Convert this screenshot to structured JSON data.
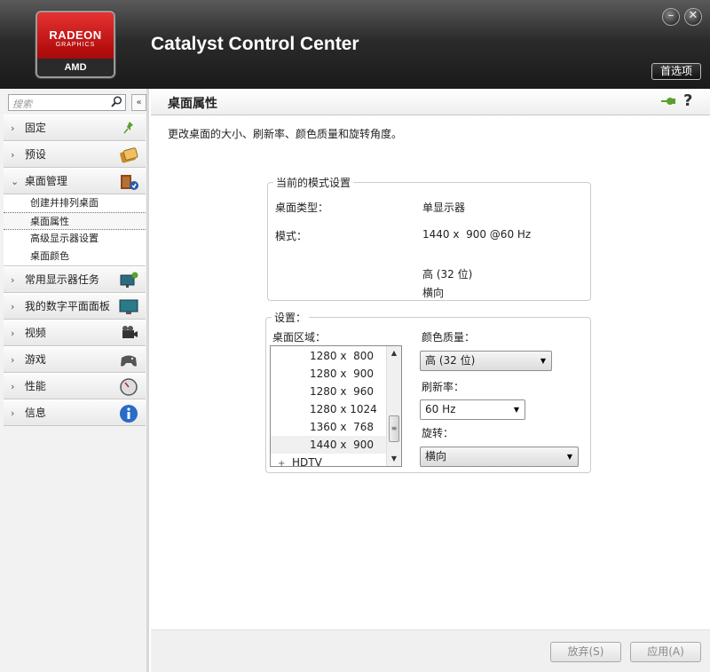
{
  "header": {
    "logo": {
      "line1": "RADEON",
      "line2": "GRAPHICS",
      "brand": "AMD"
    },
    "title": "Catalyst Control Center",
    "preferences_label": "首选项",
    "minimize_glyph": "–",
    "close_glyph": "✕"
  },
  "sidebar": {
    "search_placeholder": "搜索",
    "collapse_glyph": "«",
    "items": [
      {
        "label": "固定",
        "icon": "pin-icon",
        "expanded": false
      },
      {
        "label": "预设",
        "icon": "presets-icon",
        "expanded": false
      },
      {
        "label": "桌面管理",
        "icon": "desktop-management-icon",
        "expanded": true,
        "children": [
          "创建并排列桌面",
          "桌面属性",
          "高级显示器设置",
          "桌面颜色"
        ],
        "active_child": 1
      },
      {
        "label": "常用显示器任务",
        "icon": "display-tasks-icon",
        "expanded": false
      },
      {
        "label": "我的数字平面面板",
        "icon": "flat-panel-icon",
        "expanded": false
      },
      {
        "label": "视频",
        "icon": "video-camera-icon",
        "expanded": false
      },
      {
        "label": "游戏",
        "icon": "gamepad-icon",
        "expanded": false
      },
      {
        "label": "性能",
        "icon": "gauge-icon",
        "expanded": false
      },
      {
        "label": "信息",
        "icon": "info-icon",
        "expanded": false
      }
    ]
  },
  "main": {
    "title": "桌面属性",
    "description": "更改桌面的大小、刷新率、颜色质量和旋转角度。",
    "current_mode": {
      "legend": "当前的模式设置",
      "desktop_type_label": "桌面类型：",
      "desktop_type_value": "单显示器",
      "mode_label": "模式：",
      "mode_value": "1440 x  900 @60 Hz",
      "color_value": "高 (32 位)",
      "orientation_value": "横向"
    },
    "settings": {
      "legend": "设置：",
      "desktop_area_label": "桌面区域：",
      "resolutions": [
        "1280 x  800",
        "1280 x  900",
        "1280 x  960",
        "1280 x 1024",
        "1360 x  768",
        "1440 x  900"
      ],
      "selected_resolution": 5,
      "group_label": "HDTV",
      "group_expander": "+",
      "color_quality_label": "颜色质量：",
      "color_quality_value": "高 (32 位)",
      "refresh_rate_label": "刷新率：",
      "refresh_rate_value": "60 Hz",
      "rotation_label": "旋转：",
      "rotation_value": "横向"
    }
  },
  "footer": {
    "discard_label": "放弃(S)",
    "apply_label": "应用(A)"
  },
  "colors": {
    "header_dark": "#1a1a1a",
    "logo_red": "#c41414",
    "sidebar_bg": "#f2f2f2"
  }
}
